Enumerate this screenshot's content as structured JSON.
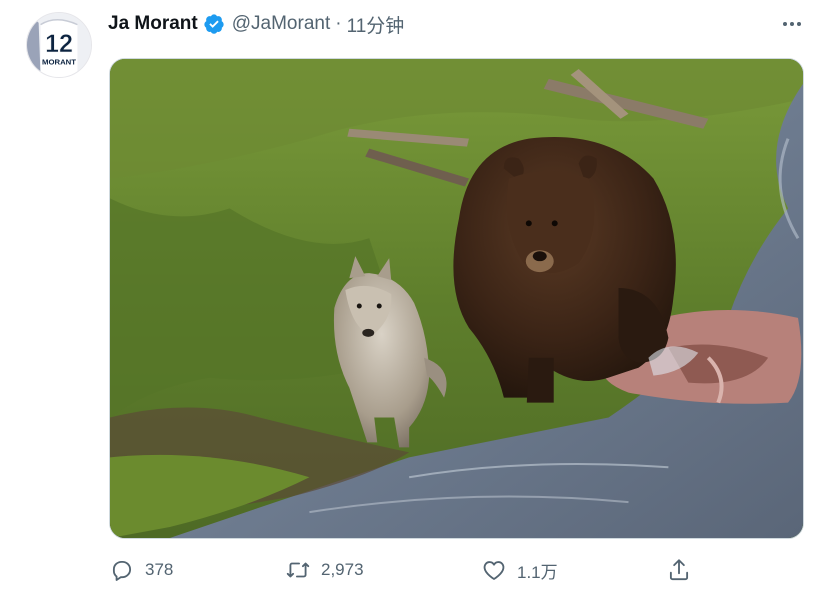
{
  "tweet": {
    "author": {
      "display_name": "Ja Morant",
      "handle": "@JaMorant",
      "verified": true,
      "avatar_jersey_number": "12",
      "avatar_jersey_name": "MORANT"
    },
    "separator": "·",
    "timestamp": "11分钟",
    "media": {
      "description_icon": "photo"
    },
    "actions": {
      "reply_count": "378",
      "retweet_count": "2,973",
      "like_count": "1.1万"
    }
  },
  "colors": {
    "text_primary": "#0f1419",
    "text_secondary": "#536471",
    "verified_blue": "#1d9bf0",
    "border": "#cfd9de"
  },
  "icons": {
    "more": "more-horizontal-icon",
    "reply": "reply-bubble-icon",
    "retweet": "retweet-arrows-icon",
    "like": "heart-icon",
    "share": "share-upload-icon",
    "verified": "verified-badge-icon"
  }
}
